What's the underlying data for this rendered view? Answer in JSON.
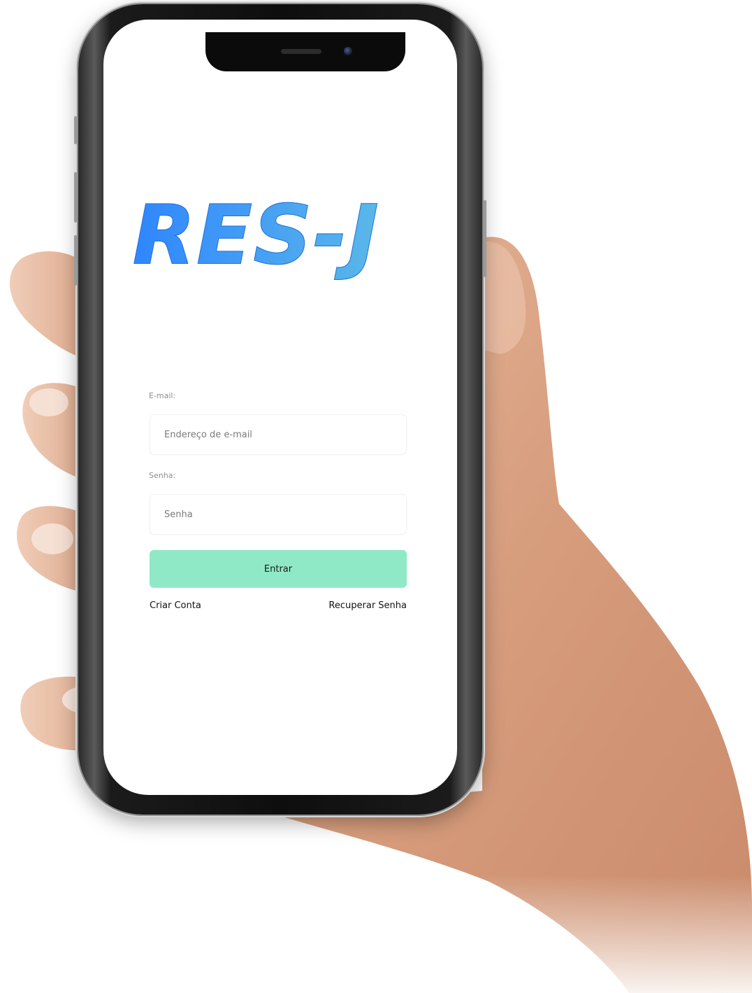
{
  "app": {
    "logo_text": "RES-J"
  },
  "login": {
    "email_label": "E-mail:",
    "email_placeholder": "Endereço de e-mail",
    "password_label": "Senha:",
    "password_placeholder": "Senha",
    "submit_label": "Entrar",
    "create_account_label": "Criar Conta",
    "recover_password_label": "Recuperar Senha"
  },
  "colors": {
    "logo_gradient_start": "#2f86ff",
    "logo_gradient_end": "#5bb8e8",
    "submit_button": "#8fe9c6",
    "screen_background": "#ffffff"
  }
}
